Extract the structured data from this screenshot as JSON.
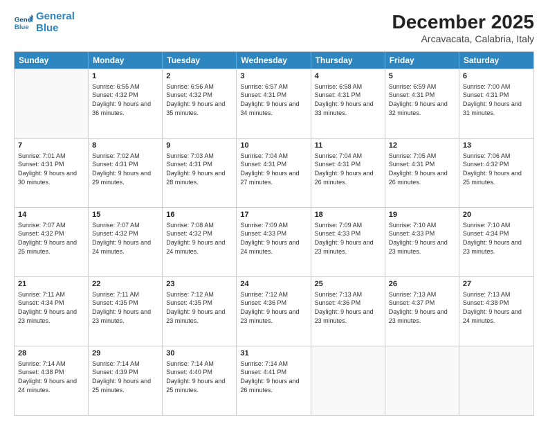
{
  "logo": {
    "line1": "General",
    "line2": "Blue"
  },
  "header": {
    "month": "December 2025",
    "location": "Arcavacata, Calabria, Italy"
  },
  "weekdays": [
    "Sunday",
    "Monday",
    "Tuesday",
    "Wednesday",
    "Thursday",
    "Friday",
    "Saturday"
  ],
  "weeks": [
    [
      {
        "day": "",
        "sunrise": "",
        "sunset": "",
        "daylight": "",
        "empty": true
      },
      {
        "day": "1",
        "sunrise": "Sunrise: 6:55 AM",
        "sunset": "Sunset: 4:32 PM",
        "daylight": "Daylight: 9 hours and 36 minutes."
      },
      {
        "day": "2",
        "sunrise": "Sunrise: 6:56 AM",
        "sunset": "Sunset: 4:32 PM",
        "daylight": "Daylight: 9 hours and 35 minutes."
      },
      {
        "day": "3",
        "sunrise": "Sunrise: 6:57 AM",
        "sunset": "Sunset: 4:31 PM",
        "daylight": "Daylight: 9 hours and 34 minutes."
      },
      {
        "day": "4",
        "sunrise": "Sunrise: 6:58 AM",
        "sunset": "Sunset: 4:31 PM",
        "daylight": "Daylight: 9 hours and 33 minutes."
      },
      {
        "day": "5",
        "sunrise": "Sunrise: 6:59 AM",
        "sunset": "Sunset: 4:31 PM",
        "daylight": "Daylight: 9 hours and 32 minutes."
      },
      {
        "day": "6",
        "sunrise": "Sunrise: 7:00 AM",
        "sunset": "Sunset: 4:31 PM",
        "daylight": "Daylight: 9 hours and 31 minutes."
      }
    ],
    [
      {
        "day": "7",
        "sunrise": "Sunrise: 7:01 AM",
        "sunset": "Sunset: 4:31 PM",
        "daylight": "Daylight: 9 hours and 30 minutes."
      },
      {
        "day": "8",
        "sunrise": "Sunrise: 7:02 AM",
        "sunset": "Sunset: 4:31 PM",
        "daylight": "Daylight: 9 hours and 29 minutes."
      },
      {
        "day": "9",
        "sunrise": "Sunrise: 7:03 AM",
        "sunset": "Sunset: 4:31 PM",
        "daylight": "Daylight: 9 hours and 28 minutes."
      },
      {
        "day": "10",
        "sunrise": "Sunrise: 7:04 AM",
        "sunset": "Sunset: 4:31 PM",
        "daylight": "Daylight: 9 hours and 27 minutes."
      },
      {
        "day": "11",
        "sunrise": "Sunrise: 7:04 AM",
        "sunset": "Sunset: 4:31 PM",
        "daylight": "Daylight: 9 hours and 26 minutes."
      },
      {
        "day": "12",
        "sunrise": "Sunrise: 7:05 AM",
        "sunset": "Sunset: 4:31 PM",
        "daylight": "Daylight: 9 hours and 26 minutes."
      },
      {
        "day": "13",
        "sunrise": "Sunrise: 7:06 AM",
        "sunset": "Sunset: 4:32 PM",
        "daylight": "Daylight: 9 hours and 25 minutes."
      }
    ],
    [
      {
        "day": "14",
        "sunrise": "Sunrise: 7:07 AM",
        "sunset": "Sunset: 4:32 PM",
        "daylight": "Daylight: 9 hours and 25 minutes."
      },
      {
        "day": "15",
        "sunrise": "Sunrise: 7:07 AM",
        "sunset": "Sunset: 4:32 PM",
        "daylight": "Daylight: 9 hours and 24 minutes."
      },
      {
        "day": "16",
        "sunrise": "Sunrise: 7:08 AM",
        "sunset": "Sunset: 4:32 PM",
        "daylight": "Daylight: 9 hours and 24 minutes."
      },
      {
        "day": "17",
        "sunrise": "Sunrise: 7:09 AM",
        "sunset": "Sunset: 4:33 PM",
        "daylight": "Daylight: 9 hours and 24 minutes."
      },
      {
        "day": "18",
        "sunrise": "Sunrise: 7:09 AM",
        "sunset": "Sunset: 4:33 PM",
        "daylight": "Daylight: 9 hours and 23 minutes."
      },
      {
        "day": "19",
        "sunrise": "Sunrise: 7:10 AM",
        "sunset": "Sunset: 4:33 PM",
        "daylight": "Daylight: 9 hours and 23 minutes."
      },
      {
        "day": "20",
        "sunrise": "Sunrise: 7:10 AM",
        "sunset": "Sunset: 4:34 PM",
        "daylight": "Daylight: 9 hours and 23 minutes."
      }
    ],
    [
      {
        "day": "21",
        "sunrise": "Sunrise: 7:11 AM",
        "sunset": "Sunset: 4:34 PM",
        "daylight": "Daylight: 9 hours and 23 minutes."
      },
      {
        "day": "22",
        "sunrise": "Sunrise: 7:11 AM",
        "sunset": "Sunset: 4:35 PM",
        "daylight": "Daylight: 9 hours and 23 minutes."
      },
      {
        "day": "23",
        "sunrise": "Sunrise: 7:12 AM",
        "sunset": "Sunset: 4:35 PM",
        "daylight": "Daylight: 9 hours and 23 minutes."
      },
      {
        "day": "24",
        "sunrise": "Sunrise: 7:12 AM",
        "sunset": "Sunset: 4:36 PM",
        "daylight": "Daylight: 9 hours and 23 minutes."
      },
      {
        "day": "25",
        "sunrise": "Sunrise: 7:13 AM",
        "sunset": "Sunset: 4:36 PM",
        "daylight": "Daylight: 9 hours and 23 minutes."
      },
      {
        "day": "26",
        "sunrise": "Sunrise: 7:13 AM",
        "sunset": "Sunset: 4:37 PM",
        "daylight": "Daylight: 9 hours and 23 minutes."
      },
      {
        "day": "27",
        "sunrise": "Sunrise: 7:13 AM",
        "sunset": "Sunset: 4:38 PM",
        "daylight": "Daylight: 9 hours and 24 minutes."
      }
    ],
    [
      {
        "day": "28",
        "sunrise": "Sunrise: 7:14 AM",
        "sunset": "Sunset: 4:38 PM",
        "daylight": "Daylight: 9 hours and 24 minutes."
      },
      {
        "day": "29",
        "sunrise": "Sunrise: 7:14 AM",
        "sunset": "Sunset: 4:39 PM",
        "daylight": "Daylight: 9 hours and 25 minutes."
      },
      {
        "day": "30",
        "sunrise": "Sunrise: 7:14 AM",
        "sunset": "Sunset: 4:40 PM",
        "daylight": "Daylight: 9 hours and 25 minutes."
      },
      {
        "day": "31",
        "sunrise": "Sunrise: 7:14 AM",
        "sunset": "Sunset: 4:41 PM",
        "daylight": "Daylight: 9 hours and 26 minutes."
      },
      {
        "day": "",
        "sunrise": "",
        "sunset": "",
        "daylight": "",
        "empty": true
      },
      {
        "day": "",
        "sunrise": "",
        "sunset": "",
        "daylight": "",
        "empty": true
      },
      {
        "day": "",
        "sunrise": "",
        "sunset": "",
        "daylight": "",
        "empty": true
      }
    ]
  ]
}
